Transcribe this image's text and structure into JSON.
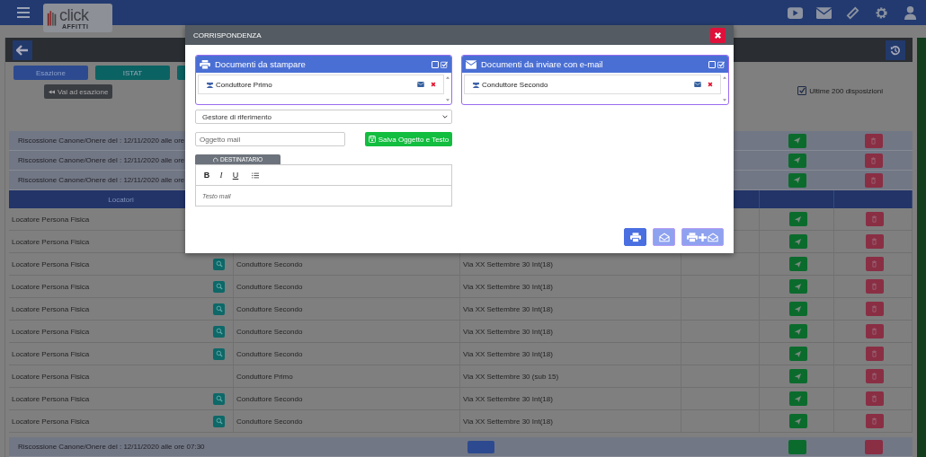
{
  "header": {
    "logo_text": "click",
    "logo_subtext": "AFFITTI"
  },
  "filters": [
    {
      "label": "Esazione",
      "kind": "blue"
    },
    {
      "label": "ISTAT",
      "kind": "teal"
    }
  ],
  "goto_button": "Vai ad esazione",
  "last_200": {
    "label": "Ultime 200 disposizioni",
    "checked": true
  },
  "groups_top": [
    "Riscossione Canone/Onere del : 12/11/2020 alle ore",
    "Riscossione Canone/Onere del : 12/11/2020 alle ore",
    "Riscossione Canone/Onere del : 12/11/2020 alle ore"
  ],
  "table": {
    "columns": [
      "Locatori"
    ],
    "rows": [
      {
        "locatore": "Locatore Persona Fisica",
        "zoom": false
      },
      {
        "locatore": "Locatore Persona Fisica",
        "zoom": false
      },
      {
        "locatore": "Locatore Persona Fisica",
        "zoom": true,
        "conduttore": "Conduttore Secondo",
        "indirizzo": "Via XX Settembre 30 Int(18)"
      },
      {
        "locatore": "Locatore Persona Fisica",
        "zoom": true,
        "conduttore": "Conduttore Secondo",
        "indirizzo": "Via XX Settembre 30 Int(18)"
      },
      {
        "locatore": "Locatore Persona Fisica",
        "zoom": true,
        "conduttore": "Conduttore Secondo",
        "indirizzo": "Via XX Settembre 30 Int(18)"
      },
      {
        "locatore": "Locatore Persona Fisica",
        "zoom": true,
        "conduttore": "Conduttore Secondo",
        "indirizzo": "Via XX Settembre 30 Int(18)"
      },
      {
        "locatore": "Locatore Persona Fisica",
        "zoom": true,
        "conduttore": "Conduttore Secondo",
        "indirizzo": "Via XX Settembre 30 Int(18)"
      },
      {
        "locatore": "Locatore Persona Fisica",
        "zoom": false,
        "conduttore": "Conduttore Primo",
        "indirizzo": "Via XX Settembre 30 (sub 15)"
      },
      {
        "locatore": "Locatore Persona Fisica",
        "zoom": true,
        "conduttore": "Conduttore Secondo",
        "indirizzo": "Via XX Settembre 30 Int(18)"
      },
      {
        "locatore": "Locatore Persona Fisica",
        "zoom": true,
        "conduttore": "Conduttore Secondo",
        "indirizzo": "Via XX Settembre 30 Int(18)"
      }
    ]
  },
  "group_bottom": "Riscossione Canone/Onere del : 12/11/2020 alle ore 07:30",
  "modal": {
    "title": "CORRISPONDENZA",
    "panels": [
      {
        "kind": "print",
        "title": "Documenti da stampare",
        "items": [
          {
            "name": "Conduttore Primo"
          }
        ]
      },
      {
        "kind": "email",
        "title": "Documenti da inviare con e-mail",
        "items": [
          {
            "name": "Conduttore Secondo"
          }
        ]
      }
    ],
    "select": {
      "value": "Gestore di riferimento"
    },
    "subject": {
      "placeholder": "Oggetto mail"
    },
    "save_button": "Salva Oggetto e Testo",
    "recipient_tab": "DESTINATARIO",
    "editor": {
      "toolbar": [
        "B",
        "I",
        "U"
      ],
      "placeholder": "Testo mail"
    },
    "actions": [
      {
        "kind": "print",
        "disabled": false
      },
      {
        "kind": "email",
        "disabled": true
      },
      {
        "kind": "both",
        "disabled": true
      }
    ]
  }
}
